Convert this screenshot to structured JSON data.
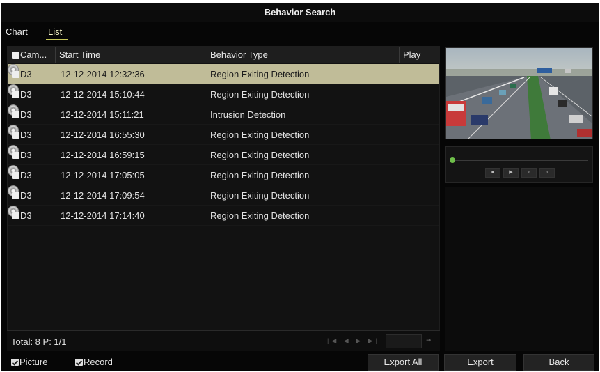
{
  "window": {
    "title": "Behavior Search"
  },
  "tabs": [
    {
      "label": "Chart",
      "active": false
    },
    {
      "label": "List",
      "active": true
    }
  ],
  "table": {
    "columns": [
      "Cam...",
      "Start Time",
      "Behavior Type",
      "Play"
    ],
    "rows": [
      {
        "camera": "D3",
        "start_time": "12-12-2014 12:32:36",
        "behavior_type": "Region Exiting Detection",
        "selected": true
      },
      {
        "camera": "D3",
        "start_time": "12-12-2014 15:10:44",
        "behavior_type": "Region Exiting Detection",
        "selected": false
      },
      {
        "camera": "D3",
        "start_time": "12-12-2014 15:11:21",
        "behavior_type": "Intrusion Detection",
        "selected": false
      },
      {
        "camera": "D3",
        "start_time": "12-12-2014 16:55:30",
        "behavior_type": "Region Exiting Detection",
        "selected": false
      },
      {
        "camera": "D3",
        "start_time": "12-12-2014 16:59:15",
        "behavior_type": "Region Exiting Detection",
        "selected": false
      },
      {
        "camera": "D3",
        "start_time": "12-12-2014 17:05:05",
        "behavior_type": "Region Exiting Detection",
        "selected": false
      },
      {
        "camera": "D3",
        "start_time": "12-12-2014 17:09:54",
        "behavior_type": "Region Exiting Detection",
        "selected": false
      },
      {
        "camera": "D3",
        "start_time": "12-12-2014 17:14:40",
        "behavior_type": "Region Exiting Detection",
        "selected": false
      }
    ],
    "play_icon": "play-disc-icon"
  },
  "footer": {
    "total": "Total: 8  P: 1/1"
  },
  "pager_icons": [
    "first-page-icon",
    "prev-page-icon",
    "next-page-icon",
    "last-page-icon",
    "go-page-icon"
  ],
  "player": {
    "progress": 0.0,
    "controls": [
      "stop-icon",
      "play-icon",
      "step-back-icon",
      "step-forward-icon"
    ]
  },
  "bottom": {
    "picture_label": "Picture",
    "picture_checked": true,
    "record_label": "Record",
    "record_checked": true,
    "export_all_label": "Export All",
    "export_label": "Export",
    "back_label": "Back"
  },
  "colors": {
    "background": "#060606",
    "selected_row": "#c0bc98",
    "tab_underline": "#c8c85a",
    "progress_knob": "#6fbf4a"
  }
}
